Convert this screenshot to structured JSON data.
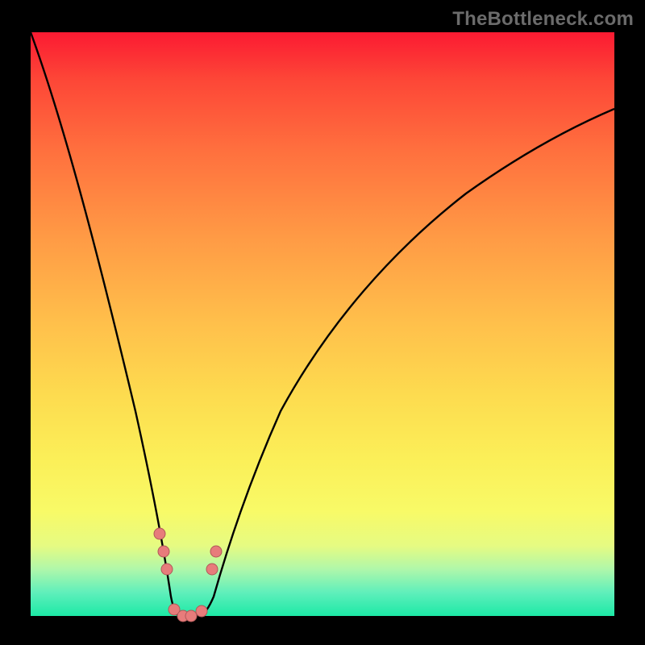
{
  "watermark": {
    "text": "TheBottleneck.com"
  },
  "colors": {
    "frame": "#000000",
    "curve_stroke": "#000000",
    "marker_fill": "#e77c7b",
    "marker_stroke": "#b05858",
    "gradient_stops": [
      "#fb1a32",
      "#fd4637",
      "#ff6f3e",
      "#ff9a45",
      "#ffc04b",
      "#fddb4f",
      "#fbef58",
      "#f8fa67",
      "#e6fb82",
      "#aff7aa",
      "#5fefbb",
      "#1ce9a6"
    ]
  },
  "chart_data": {
    "type": "line",
    "title": "",
    "xlabel": "",
    "ylabel": "",
    "xlim": [
      0,
      100
    ],
    "ylim": [
      0,
      100
    ],
    "grid": false,
    "notes": "V-shaped bottleneck curve on rainbow gradient. High y = bad (red), low y = good (green). Minimum y≈0 around x≈24–30. Axes draw top-left origin; y shown here is data value (0 = bottom/green).",
    "series": [
      {
        "name": "bottleneck-curve",
        "x": [
          0,
          3,
          6,
          9,
          12,
          15,
          18,
          21,
          23,
          24,
          26,
          28,
          30,
          33,
          36,
          40,
          45,
          50,
          55,
          60,
          65,
          70,
          75,
          80,
          85,
          90,
          95,
          100
        ],
        "values": [
          100,
          94,
          87,
          79,
          70,
          58,
          44,
          26,
          12,
          2,
          0,
          0,
          2,
          11,
          22,
          33,
          44,
          52,
          59,
          65,
          70,
          74,
          78,
          81,
          83,
          85,
          87,
          88
        ]
      }
    ],
    "markers": [
      {
        "x": 22.0,
        "y": 14
      },
      {
        "x": 22.7,
        "y": 11
      },
      {
        "x": 23.3,
        "y": 8
      },
      {
        "x": 24.5,
        "y": 1
      },
      {
        "x": 26.0,
        "y": 0
      },
      {
        "x": 27.5,
        "y": 0
      },
      {
        "x": 29.2,
        "y": 1
      },
      {
        "x": 31.0,
        "y": 8
      },
      {
        "x": 31.8,
        "y": 11
      }
    ]
  }
}
